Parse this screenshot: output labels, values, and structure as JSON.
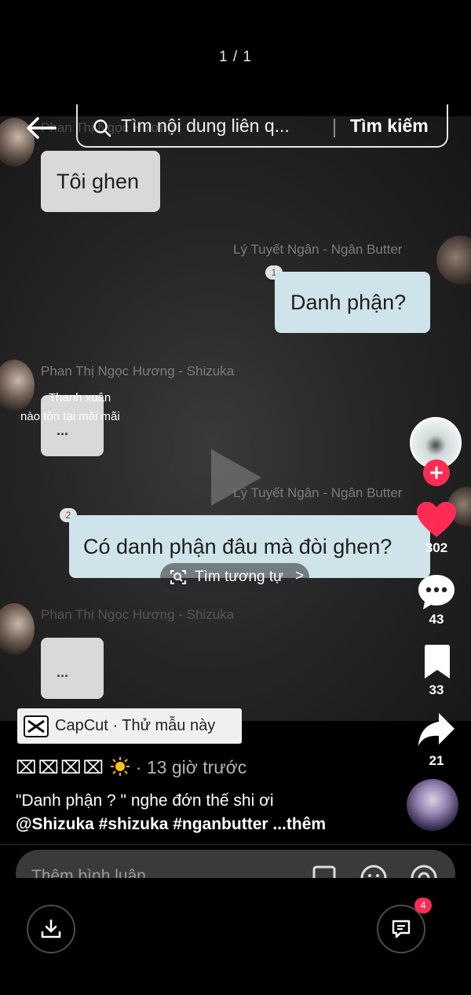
{
  "viewer": {
    "counter": "1 / 1"
  },
  "search": {
    "placeholder": "Tìm nội dung liên q...",
    "button": "Tìm kiếm"
  },
  "chat": {
    "msg1": {
      "name": "Phan Thị Ngọc Hương",
      "text": "Tôi ghen"
    },
    "msg2": {
      "name": "Lý Tuyết Ngân - Ngân Butter",
      "badge": "1",
      "text": "Danh phận?"
    },
    "msg3": {
      "name": "Phan Thị Ngọc Hương - Shizuka",
      "overlay_line1": "Thanh xuân",
      "overlay_line2": "nào tồn tại mãi mãi",
      "text": "..."
    },
    "msg4": {
      "name": "Lý Tuyết Ngân - Ngân Butter",
      "badge": "2",
      "text": "Có danh phận đâu mà đòi ghen?"
    },
    "msg5": {
      "name": "Phan Thị Ngọc Hương - Shizuka",
      "text": "..."
    }
  },
  "find_similar": {
    "label": "Tìm tương tự",
    "chevron": ">"
  },
  "rail": {
    "likes": "302",
    "comments": "43",
    "saves": "33",
    "shares": "21"
  },
  "caption": {
    "capcut": "CapCut · Thử mẫu này",
    "author_boxes": "⌧⌧⌧⌧",
    "time": "· 13 giờ trước",
    "text": "\"Danh phận ? \" nghe đớn thế shi ơi",
    "tags": "@Shizuka #shizuka #nganbutter ...thêm"
  },
  "comment": {
    "placeholder": "Thêm bình luận..."
  },
  "bottom": {
    "chat_badge": "4"
  },
  "colors": {
    "like": "#fe2c55",
    "follow": "#fe2c55",
    "bubble_right": "#cfe3ea",
    "bubble_left": "#d9d9d9"
  }
}
